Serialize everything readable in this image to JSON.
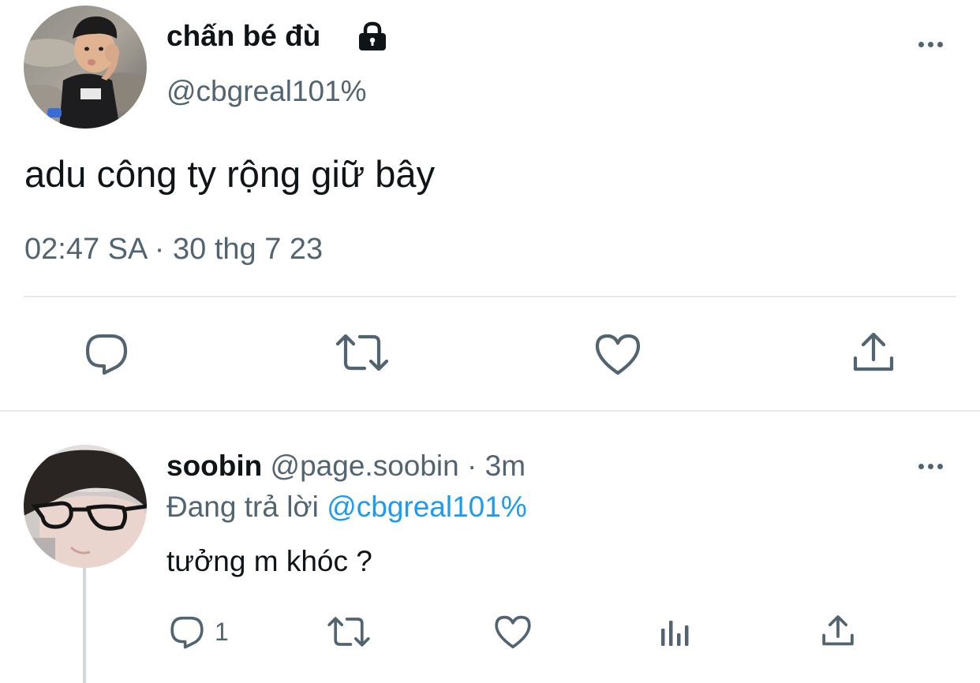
{
  "main_tweet": {
    "display_name": "chấn bé đù",
    "handle": "@cbgreal101%",
    "text": "adu công ty rộng giữ bây",
    "timestamp": "02:47 SA · 30 thg 7 23",
    "icons": [
      "lock-icon",
      "more-icon",
      "reply-icon",
      "retweet-icon",
      "like-icon",
      "share-icon"
    ]
  },
  "reply_tweet": {
    "display_name": "soobin",
    "handle": "@page.soobin",
    "separator": "·",
    "time_ago": "3m",
    "replying_prefix": "Đang trả lời",
    "replying_to": "@cbgreal101%",
    "text": "tưởng m khóc ?",
    "reply_count": "1",
    "icons": [
      "more-icon",
      "reply-icon",
      "retweet-icon",
      "like-icon",
      "analytics-icon",
      "share-icon"
    ]
  },
  "colors": {
    "text": "#0f1419",
    "muted": "#536471",
    "link": "#1d9bf0",
    "divider": "#e6e9ea"
  }
}
